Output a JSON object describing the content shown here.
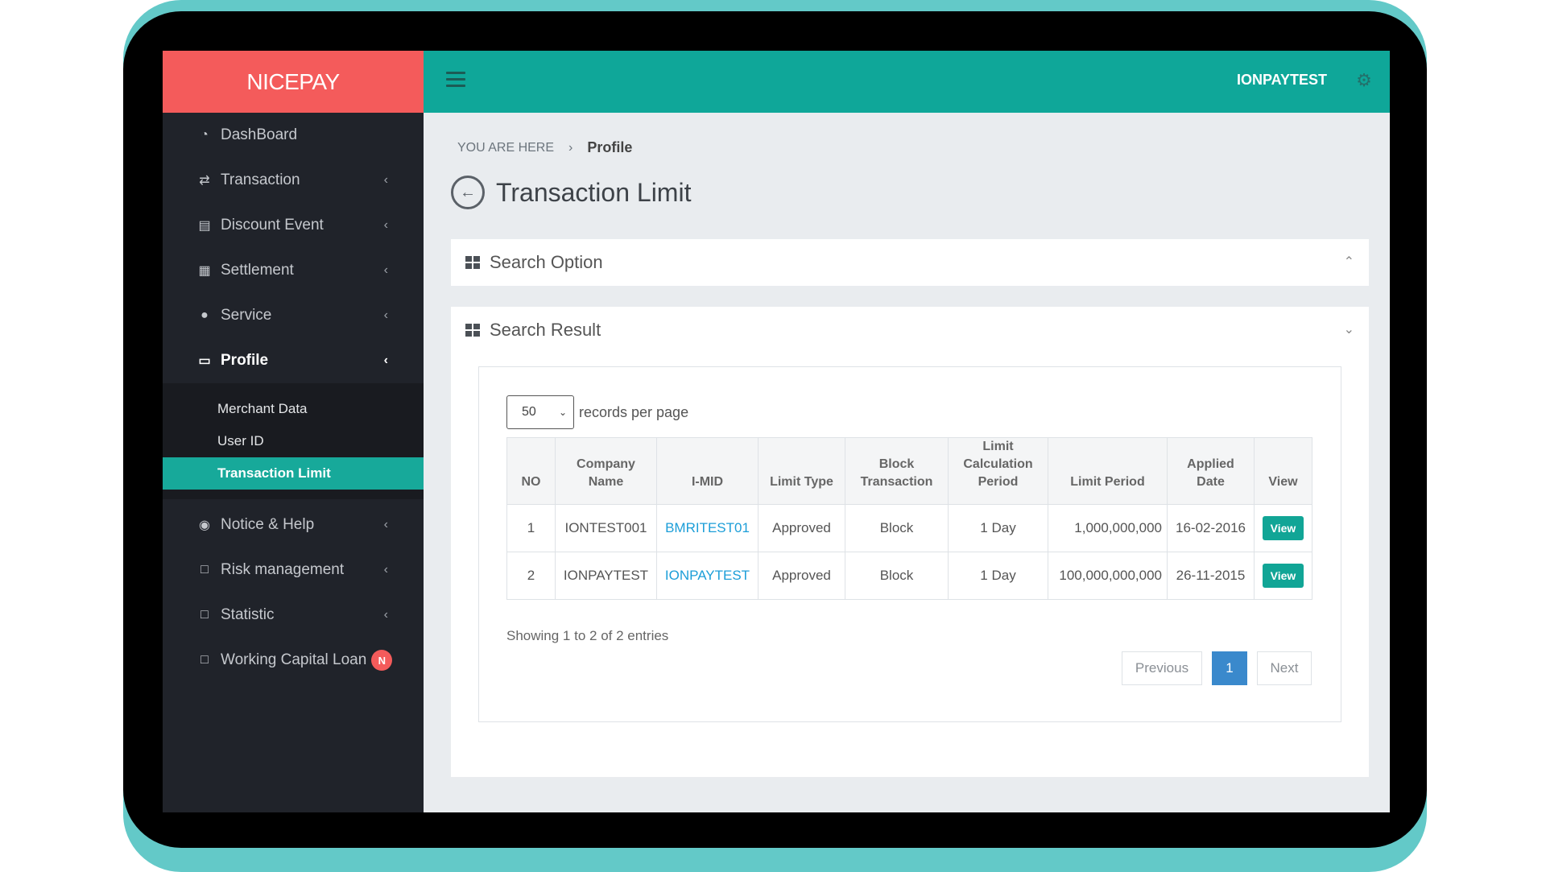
{
  "brand": "NICEPAY",
  "header": {
    "username": "IONPAYTEST"
  },
  "sidebar": {
    "items": [
      {
        "label": "DashBoard"
      },
      {
        "label": "Transaction"
      },
      {
        "label": "Discount Event"
      },
      {
        "label": "Settlement"
      },
      {
        "label": "Service"
      },
      {
        "label": "Profile"
      }
    ],
    "submenu": [
      "Merchant Data",
      "User ID",
      "Transaction Limit"
    ],
    "items_after": [
      {
        "label": "Notice & Help"
      },
      {
        "label": "Risk management"
      },
      {
        "label": "Statistic"
      },
      {
        "label": "Working Capital Loan",
        "badge": "N"
      }
    ]
  },
  "breadcrumb": {
    "prefix": "YOU ARE HERE",
    "current": "Profile"
  },
  "page_title": "Transaction Limit",
  "search_option": {
    "title": "Search Option"
  },
  "search_result": {
    "title": "Search Result",
    "page_length": "50",
    "page_length_label": "records per page",
    "columns": [
      "NO",
      "Company Name",
      "I-MID",
      "Limit Type",
      "Block Transaction",
      "Limit Calculation Period",
      "Limit Period",
      "Applied Date",
      "View"
    ],
    "rows": [
      {
        "no": "1",
        "company": "IONTEST001",
        "imid": "BMRITEST01",
        "limit_type": "Approved",
        "block": "Block",
        "calc_period": "1 Day",
        "limit_period": "1,000,000,000",
        "applied": "16-02-2016",
        "view": "View"
      },
      {
        "no": "2",
        "company": "IONPAYTEST",
        "imid": "IONPAYTEST",
        "limit_type": "Approved",
        "block": "Block",
        "calc_period": "1 Day",
        "limit_period": "100,000,000,000",
        "applied": "26-11-2015",
        "view": "View"
      }
    ],
    "info": "Showing 1 to 2 of 2 entries",
    "pager": {
      "previous": "Previous",
      "page": "1",
      "next": "Next"
    }
  },
  "colors": {
    "brand": "#f45b5b",
    "teal": "#0fa799",
    "sidebar": "#20232a",
    "link": "#1c9ed8",
    "page_active": "#3a89cc"
  }
}
